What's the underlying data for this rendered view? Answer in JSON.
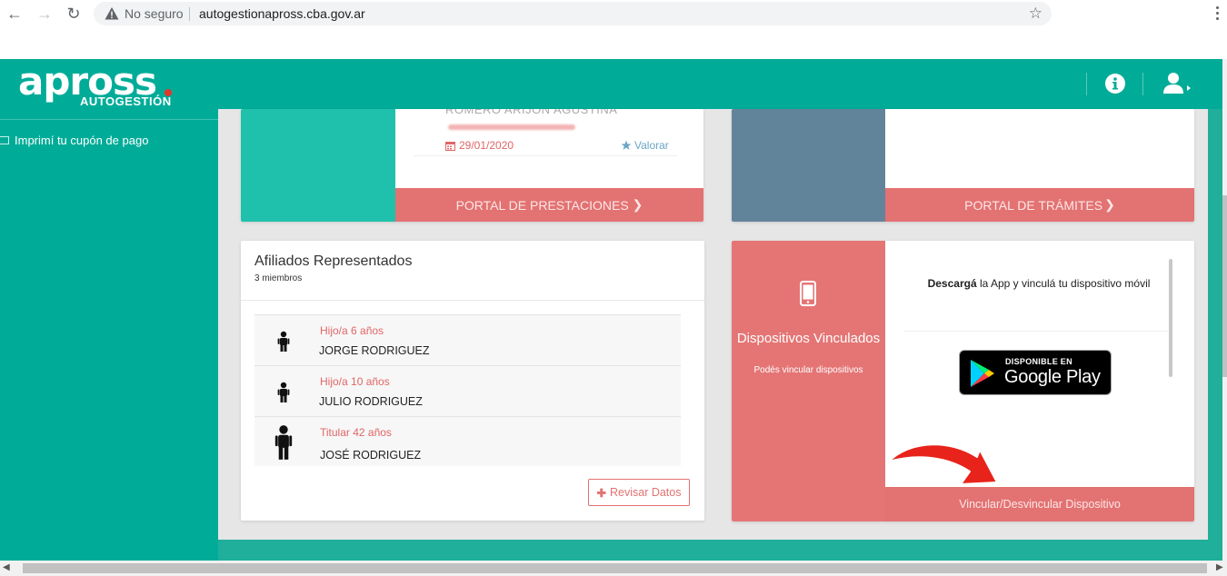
{
  "browser": {
    "security_label": "No seguro",
    "url": "autogestionapross.cba.gov.ar"
  },
  "header": {
    "logo_text": "apross",
    "logo_subtitle": "AUTOGESTIÓN"
  },
  "sidebar": {
    "items": [
      {
        "label": "Imprimí tu cupón de pago"
      }
    ]
  },
  "prestaciones_card": {
    "name": "ROMERO ARIJON AGUSTINA",
    "date": "29/01/2020",
    "rate_label": "Valorar",
    "button_label": "PORTAL DE PRESTACIONES"
  },
  "tramites_card": {
    "button_label": "PORTAL DE TRÁMITES"
  },
  "affiliates_card": {
    "title": "Afiliados Representados",
    "count": "3 miembros",
    "members": [
      {
        "role": "Hijo/a 6 años",
        "name": "JORGE RODRIGUEZ"
      },
      {
        "role": "Hijo/a 10 años",
        "name": "JULIO RODRIGUEZ"
      },
      {
        "role": "Titular 42 años",
        "name": "JOSÉ RODRIGUEZ"
      }
    ],
    "review_label": "Revisar Datos"
  },
  "devices_card": {
    "title": "Dispositivos Vinculados",
    "subtitle": "Podés vincular dispositivos",
    "desc_bold": "Descargá",
    "desc_rest": " la App y vinculá tu dispositivo móvil",
    "store_line1": "DISPONIBLE EN",
    "store_line2": "Google Play",
    "button_label": "Vincular/Desvincular Dispositivo"
  },
  "colors": {
    "teal": "#00ac98",
    "coral": "#e37272",
    "slate": "#61849b"
  }
}
